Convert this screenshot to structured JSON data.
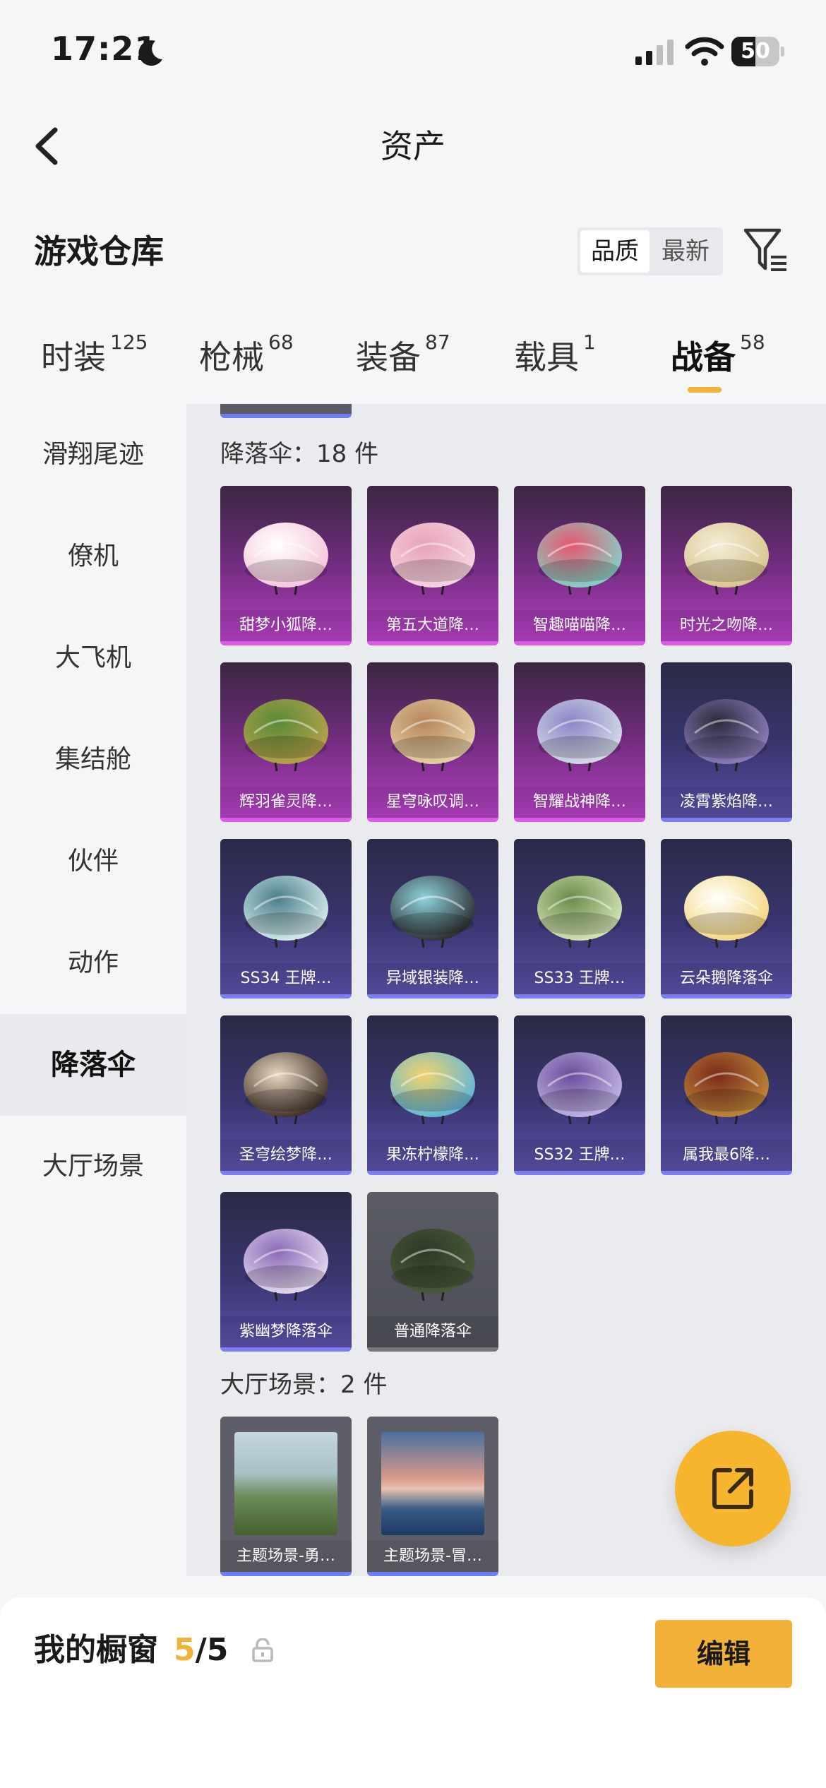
{
  "status_bar": {
    "time": "17:21",
    "battery": "50",
    "battery_level": 0.5
  },
  "nav": {
    "title": "资产"
  },
  "section": {
    "title": "游戏仓库",
    "sort_options": [
      "品质",
      "最新"
    ],
    "sort_selected": "品质"
  },
  "tabs": [
    {
      "label": "时装",
      "count": "125"
    },
    {
      "label": "枪械",
      "count": "68"
    },
    {
      "label": "装备",
      "count": "87"
    },
    {
      "label": "载具",
      "count": "1"
    },
    {
      "label": "战备",
      "count": "58"
    }
  ],
  "active_tab": "战备",
  "sidebar": {
    "items": [
      "滑翔尾迹",
      "僚机",
      "大飞机",
      "集结舱",
      "伙伴",
      "动作",
      "降落伞",
      "大厅场景"
    ],
    "active": "降落伞"
  },
  "groups": [
    {
      "label": "降落伞：18 件",
      "items": [
        {
          "name": "甜梦小狐降…",
          "rarity": "pink"
        },
        {
          "name": "第五大道降…",
          "rarity": "pink"
        },
        {
          "name": "智趣喵喵降…",
          "rarity": "pink"
        },
        {
          "name": "时光之吻降…",
          "rarity": "pink"
        },
        {
          "name": "辉羽雀灵降…",
          "rarity": "pink"
        },
        {
          "name": "星穹咏叹调…",
          "rarity": "pink"
        },
        {
          "name": "智耀战神降…",
          "rarity": "pink"
        },
        {
          "name": "凌霄紫焰降…",
          "rarity": "purple"
        },
        {
          "name": "SS34 王牌…",
          "rarity": "purple"
        },
        {
          "name": "异域银装降…",
          "rarity": "purple"
        },
        {
          "name": "SS33 王牌…",
          "rarity": "purple"
        },
        {
          "name": "云朵鹅降落伞",
          "rarity": "purple"
        },
        {
          "name": "圣穹绘梦降…",
          "rarity": "purple"
        },
        {
          "name": "果冻柠檬降…",
          "rarity": "purple"
        },
        {
          "name": "SS32 王牌…",
          "rarity": "purple"
        },
        {
          "name": "属我最6降…",
          "rarity": "purple"
        },
        {
          "name": "紫幽梦降落伞",
          "rarity": "purple"
        },
        {
          "name": "普通降落伞",
          "rarity": "gray"
        }
      ]
    },
    {
      "label": "大厅场景：2 件",
      "items": [
        {
          "name": "主题场景-勇…",
          "rarity": "scene"
        },
        {
          "name": "主题场景-冒…",
          "rarity": "scene"
        }
      ]
    }
  ],
  "bottom": {
    "label": "我的橱窗",
    "current": "5",
    "total": "/5",
    "edit_label": "编辑"
  },
  "colors": {
    "accent": "#f2b23a",
    "pink_rarity": "#b23fc1",
    "purple_rarity": "#5a4fa6"
  }
}
